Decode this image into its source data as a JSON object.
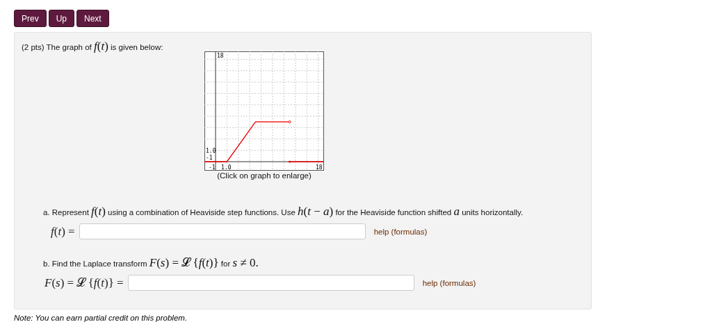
{
  "nav_buttons": [
    "Prev",
    "Up",
    "Next"
  ],
  "intro": [
    {
      "kind": "text",
      "s": "(2 pts) The graph of "
    },
    {
      "kind": "math",
      "s": "*f*(*t*)"
    },
    {
      "kind": "text",
      "s": " is given below:"
    }
  ],
  "graph": {
    "tick_labels": [
      {
        "kind": "y_top",
        "s": "18"
      },
      {
        "kind": "y_one",
        "s": "1.0"
      },
      {
        "kind": "x_neg",
        "s": "-1"
      },
      {
        "kind": "y_neg",
        "s": "-1"
      },
      {
        "kind": "x_one",
        "s": "1.0"
      },
      {
        "kind": "x_right",
        "s": "18"
      }
    ],
    "caption": "(Click on graph to enlarge)"
  },
  "parts": [
    {
      "prompt": [
        {
          "kind": "text",
          "s": "a. Represent "
        },
        {
          "kind": "math",
          "s": "*f*(*t*)"
        },
        {
          "kind": "text",
          "s": " using a combination of Heaviside step functions. Use "
        },
        {
          "kind": "math",
          "s": "*h*(*t* − *a*)"
        },
        {
          "kind": "text",
          "s": " for the Heaviside function shifted "
        },
        {
          "kind": "math",
          "s": "*a*"
        },
        {
          "kind": "text",
          "s": " units horizontally."
        }
      ],
      "answer_label": "*f*(*t*) =",
      "help": "help (formulas)"
    },
    {
      "prompt": [
        {
          "kind": "text",
          "s": "b. Find the Laplace transform "
        },
        {
          "kind": "math",
          "s": "*F*(*s*) = 𝓛 {*f*(*t*)}"
        },
        {
          "kind": "text",
          "s": " for "
        },
        {
          "kind": "math",
          "s": "*s* ≠ 0."
        }
      ],
      "answer_label": "*F*(*s*) = 𝓛 {*f*(*t*)} =",
      "help": "help (formulas)"
    }
  ],
  "note": "Note: You can earn partial credit on this problem."
}
